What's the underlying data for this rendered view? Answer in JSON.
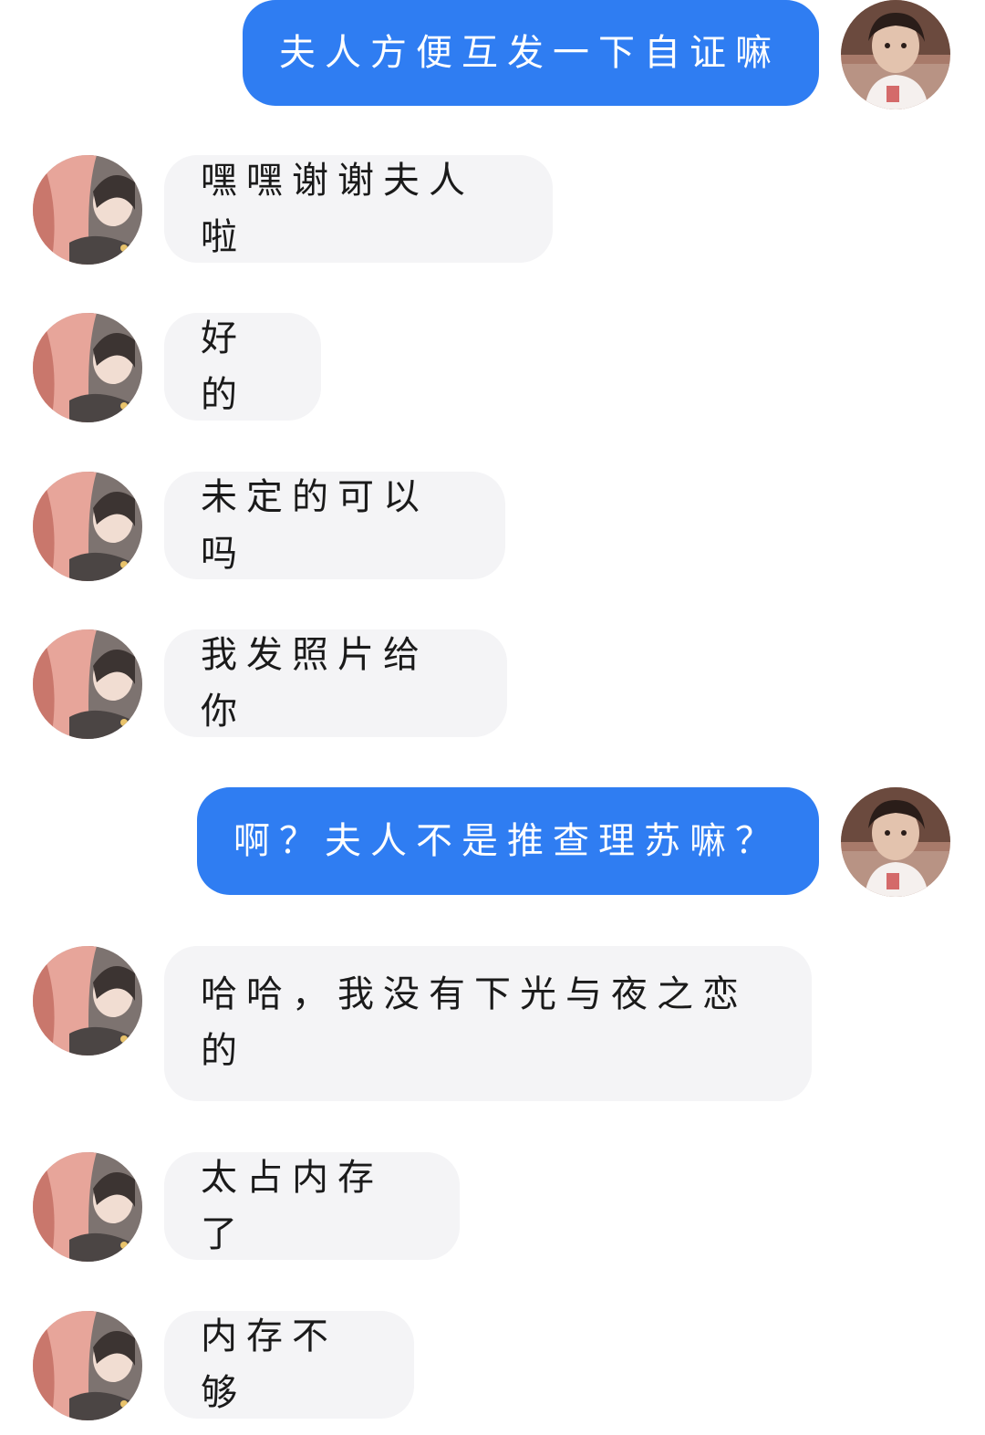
{
  "messages": [
    {
      "side": "out",
      "text": "夫人方便互发一下自证嘛"
    },
    {
      "side": "in",
      "text": "嘿嘿谢谢夫人啦"
    },
    {
      "side": "in",
      "text": "好的"
    },
    {
      "side": "in",
      "text": "未定的可以吗"
    },
    {
      "side": "in",
      "text": "我发照片给你"
    },
    {
      "side": "out",
      "text": "啊？夫人不是推查理苏嘛？"
    },
    {
      "side": "in",
      "text": "哈哈，我没有下光与夜之恋的"
    },
    {
      "side": "in",
      "text": "太占内存了"
    },
    {
      "side": "in",
      "text": "内存不够"
    }
  ],
  "colors": {
    "outgoing_bubble": "#2f7df2",
    "incoming_bubble": "#f4f4f6",
    "background": "#ffffff"
  },
  "avatars": {
    "self": "user-photo-avatar",
    "contact": "anime-character-avatar"
  }
}
